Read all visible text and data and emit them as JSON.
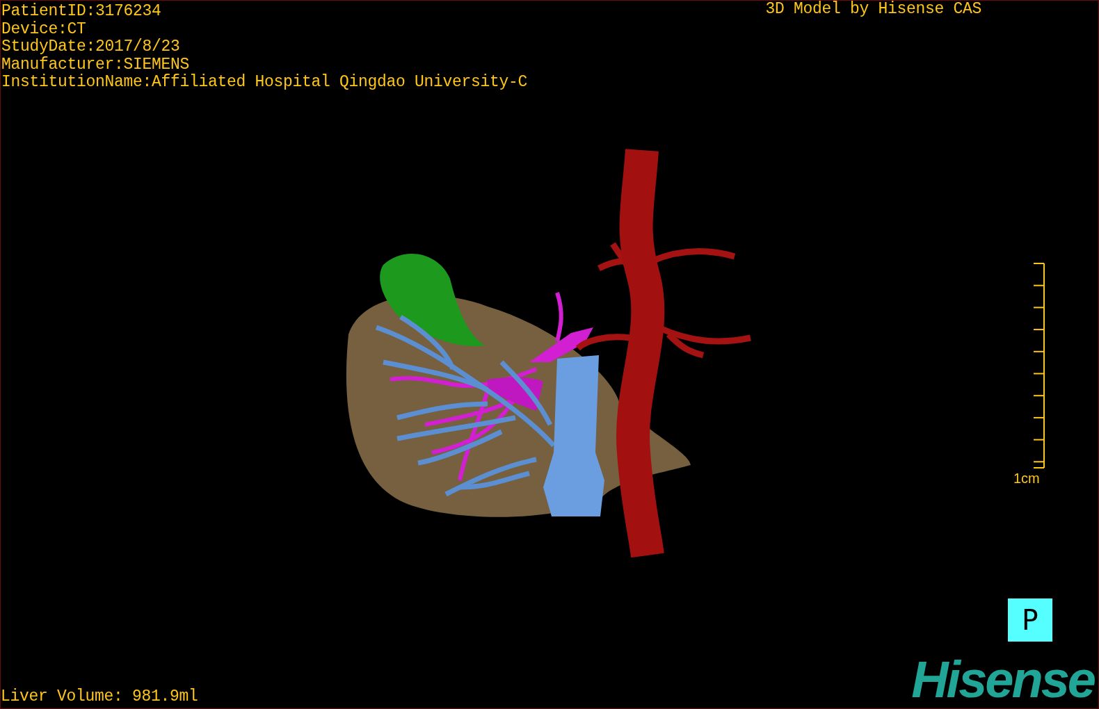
{
  "overlay": {
    "patient_info": [
      "PatientID:3176234",
      "Device:CT",
      "StudyDate:2017/8/23",
      "Manufacturer:SIEMENS",
      "InstitutionName:Affiliated Hospital Qingdao University-C"
    ],
    "title": "3D Model by Hisense CAS"
  },
  "scale_bar": {
    "label": "1cm"
  },
  "liver_volume": "Liver Volume: 981.9ml",
  "view_button": {
    "label": "P"
  },
  "logo": "Hisense"
}
